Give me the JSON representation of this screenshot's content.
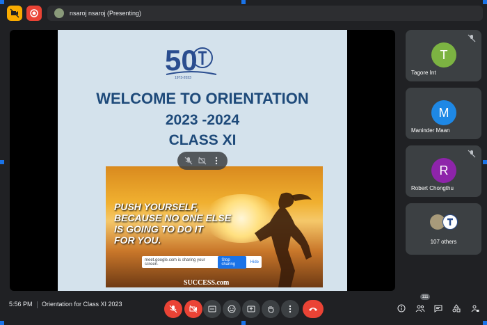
{
  "topbar": {
    "presenter_label": "nsaroj nsaroj (Presenting)"
  },
  "slide": {
    "logo_text": "50",
    "logo_years": "1973-2023",
    "title_line1": "WELCOME TO ORIENTATION",
    "title_line2": "2023 -2024",
    "title_line3": "CLASS XI",
    "poster_line1": "PUSH YOURSELF,",
    "poster_line2": "BECAUSE NO ONE ELSE",
    "poster_line3": "IS GOING TO DO IT",
    "poster_line4": "FOR YOU.",
    "poster_brand": "SUCCESS.com",
    "share_text": "meet.google.com is sharing your screen.",
    "stop_label": "Stop sharing",
    "hide_label": "Hide"
  },
  "participants": [
    {
      "initial": "T",
      "name": "Tagore Int",
      "color": "#7cb342",
      "muted": true
    },
    {
      "initial": "M",
      "name": "Maninder Maan",
      "color": "#1e88e5",
      "muted": false
    },
    {
      "initial": "R",
      "name": "Robert Chongthu",
      "color": "#8e24aa",
      "muted": true
    }
  ],
  "others": {
    "label": "107 others"
  },
  "bottombar": {
    "time": "5:56 PM",
    "meeting_name": "Orientation for Class XI 2023",
    "participant_count": "111"
  },
  "colors": {
    "background": "#202124",
    "tile": "#3c4043",
    "danger": "#ea4335",
    "accent": "#1a73e8"
  }
}
